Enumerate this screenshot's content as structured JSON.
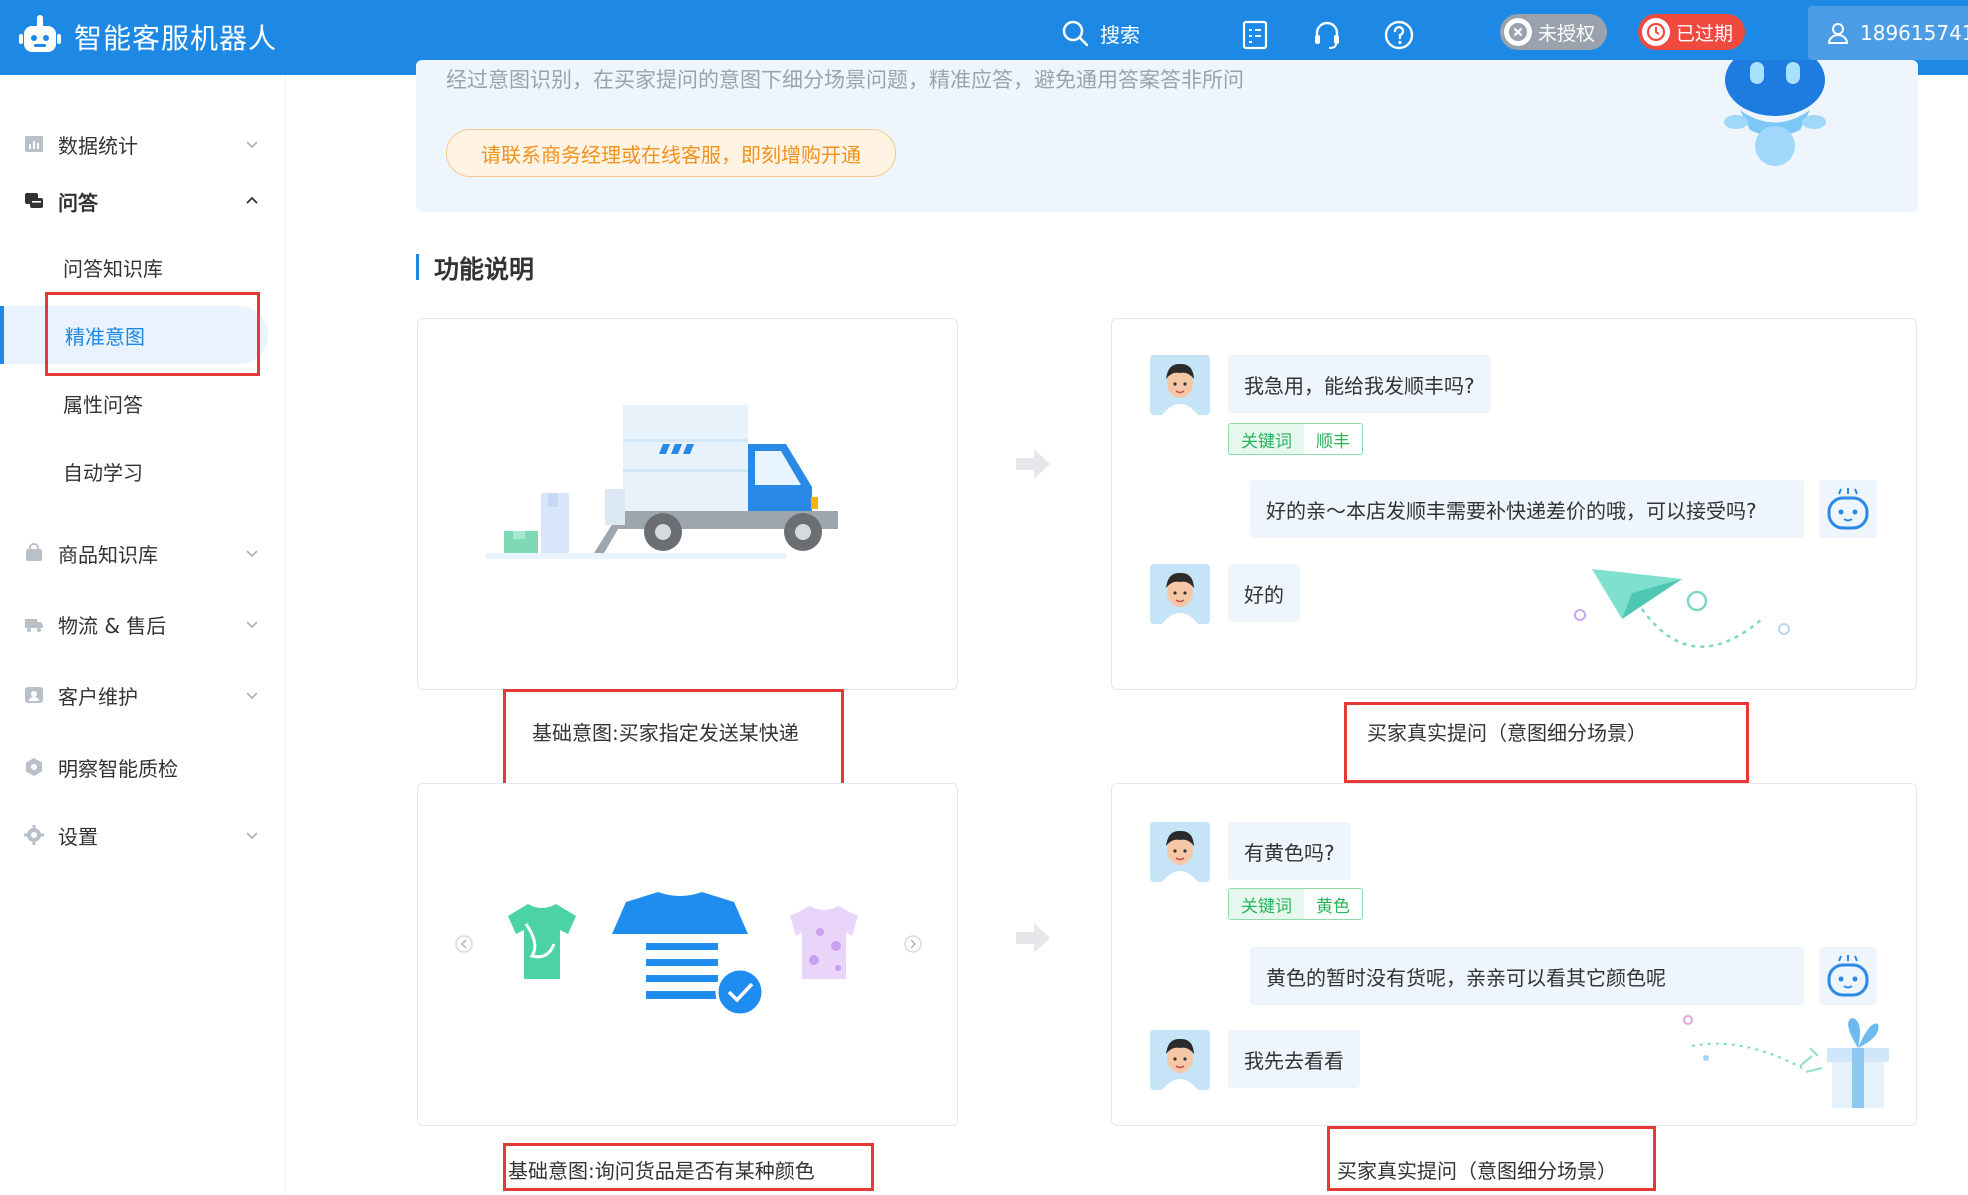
{
  "header": {
    "app_title": "智能客服机器人",
    "search_label": "搜索",
    "badge_unauthorized": "未授权",
    "badge_expired": "已过期",
    "user_phone": "189615741",
    "colors": {
      "brand": "#1e88e5",
      "badge_gray": "#9aa3ad",
      "badge_red": "#f04a3e"
    }
  },
  "sidebar": {
    "groups": [
      {
        "label": "数据统计",
        "icon": "bar-chart-icon"
      },
      {
        "label": "问答",
        "icon": "chat-icon"
      },
      {
        "label": "商品知识库",
        "icon": "bag-icon"
      },
      {
        "label": "物流 & 售后",
        "icon": "truck-icon"
      },
      {
        "label": "客户维护",
        "icon": "customer-icon"
      },
      {
        "label": "明察智能质检",
        "icon": "inspect-icon"
      },
      {
        "label": "设置",
        "icon": "settings-icon"
      }
    ],
    "qa_items": [
      {
        "label": "问答知识库"
      },
      {
        "label": "精准意图"
      },
      {
        "label": "属性问答"
      },
      {
        "label": "自动学习"
      }
    ]
  },
  "banner": {
    "description": "经过意图识别，在买家提问的意图下细分场景问题，精准应答，避免通用答案答非所问",
    "contact_button": "请联系商务经理或在线客服，即刻增购开通"
  },
  "section": {
    "title": "功能说明"
  },
  "examples": [
    {
      "basic_caption": "基础意图:买家指定发送某快递",
      "real_caption": "买家真实提问（意图细分场景）",
      "question": "我急用，能给我发顺丰吗?",
      "keyword_label": "关键词",
      "keyword_value": "顺丰",
      "answer": "好的亲～本店发顺丰需要补快递差价的哦，可以接受吗?",
      "followup": "好的"
    },
    {
      "basic_caption": "基础意图:询问货品是否有某种颜色",
      "real_caption": "买家真实提问（意图细分场景）",
      "question": "有黄色吗?",
      "keyword_label": "关键词",
      "keyword_value": "黄色",
      "answer": "黄色的暂时没有货呢，亲亲可以看其它颜色呢",
      "followup": "我先去看看"
    }
  ]
}
